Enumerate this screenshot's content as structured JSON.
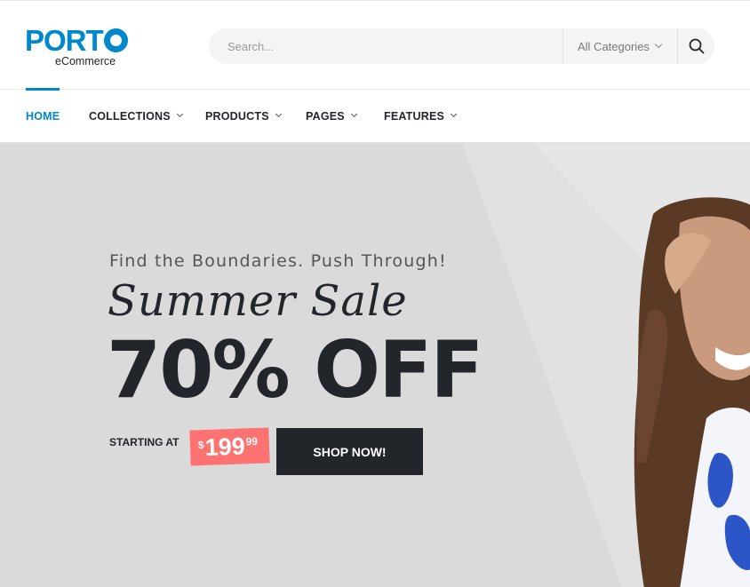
{
  "logo": {
    "word": "PORT",
    "sub": "eCommerce"
  },
  "search": {
    "placeholder": "Search...",
    "category": "All Categories",
    "button_icon": "search-icon"
  },
  "nav": {
    "items": [
      {
        "label": "HOME",
        "active": true
      },
      {
        "label": "COLLECTIONS"
      },
      {
        "label": "PRODUCTS"
      },
      {
        "label": "PAGES"
      },
      {
        "label": "FEATURES"
      }
    ]
  },
  "hero": {
    "tagline": "Find the Boundaries. Push Through!",
    "script_title": "Summer Sale",
    "big_text": "70% OFF",
    "starting_label": "STARTING AT",
    "price": {
      "currency": "$",
      "amount": "199",
      "cents": "99"
    },
    "cta_label": "SHOP NOW!"
  },
  "colors": {
    "brand": "#0088cc",
    "dark": "#222529",
    "price_badge": "#ff7272",
    "hero_bg": "#dadadb"
  }
}
